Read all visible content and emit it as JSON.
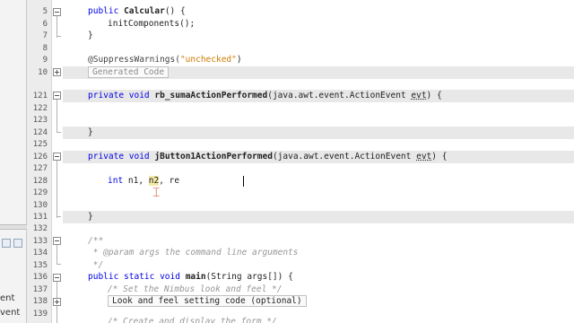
{
  "left_panel": {
    "partial_labels": [
      "ent",
      "vent"
    ]
  },
  "gutter": {
    "line_numbers": [
      "5",
      "6",
      "7",
      "8",
      "9",
      "10",
      "121",
      "122",
      "123",
      "124",
      "125",
      "126",
      "127",
      "128",
      "129",
      "130",
      "131",
      "132",
      "133",
      "134",
      "135",
      "136",
      "137",
      "138",
      "139",
      ""
    ]
  },
  "editor": {
    "code": {
      "l5": {
        "kw": "public",
        "name": "Calcular",
        "rest": "() {"
      },
      "l6": "initComponents();",
      "l7": "}",
      "l9": {
        "ann": "@SuppressWarnings(",
        "str": "\"unchecked\"",
        "end": ")"
      },
      "l10": "Generated Code",
      "l121": {
        "kw": "private void",
        "name": "rb_sumaActionPerformed",
        "rest": "(java.awt.event.ActionEvent ",
        "evt": "evt",
        "end": ") {"
      },
      "l124": "}",
      "l126": {
        "kw": "private void",
        "name": "jButton1ActionPerformed",
        "rest": "(java.awt.event.ActionEvent ",
        "evt": "evt",
        "end": ") {"
      },
      "l128": {
        "kw": "int",
        "a": " n1, ",
        "b": "n2",
        "c": ", re"
      },
      "l131": "}",
      "l133": "/**",
      "l134": " * @param args the command line arguments",
      "l135": " */",
      "l136": {
        "kw": "public static void",
        "name": "main",
        "rest": "(String args[]) {"
      },
      "l137": "/* Set the Nimbus look and feel */",
      "l138": "Look and feel setting code (optional)",
      "l139": "/* Create and display the form */"
    }
  }
}
